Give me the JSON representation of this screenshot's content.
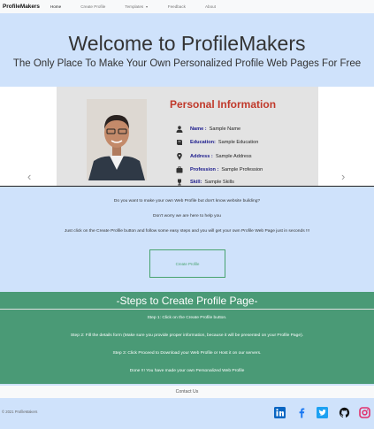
{
  "nav": {
    "brand": "ProfileMakers",
    "home": "Home",
    "create_profile": "Create Profile",
    "templates": "Templates",
    "feedback": "Feedback",
    "about": "About"
  },
  "hero": {
    "title": "Welcome to ProfileMakers",
    "subtitle": "The Only Place To Make Your Own Personalized Profile Web Pages For Free"
  },
  "carousel": {
    "heading": "Personal Information",
    "rows": [
      {
        "icon": "user-icon",
        "label": "Name :",
        "value": "Sample Name"
      },
      {
        "icon": "book-icon",
        "label": "Education:",
        "value": "Sample Education"
      },
      {
        "icon": "location-pin-icon",
        "label": "Address :",
        "value": "Sample Address"
      },
      {
        "icon": "briefcase-icon",
        "label": "Profession :",
        "value": "Sample Profession"
      },
      {
        "icon": "trophy-icon",
        "label": "Skill:",
        "value": "Sample Skills"
      }
    ],
    "prev": "‹",
    "next": "›"
  },
  "intro": {
    "line1": "Do you want to make your own Web Profile but don't know website building?",
    "line2": "Don't worry we are here to help you",
    "line3": "Just click on the Create Profile button and follow some easy steps and you will get your own Profile Web Page just in seconds !!!",
    "cta": "Create Profile"
  },
  "steps": {
    "heading": "-Steps to Create Profile Page-",
    "items": [
      "Step 1: Click on the Create Profile button.",
      "Step 2: Fill the details form (Make sure you provide proper information, because it will be presented on your Profile Page).",
      "Step 3: Click Proceed to Download your Web Profile or Host it on our servers.",
      "Done !!! You have made your own Personalized Web Profile"
    ]
  },
  "contact": {
    "label": "Contact Us"
  },
  "footer": {
    "copyright": "© 2021 ProfileMakers",
    "social": [
      "linkedin-icon",
      "facebook-icon",
      "twitter-icon",
      "github-icon",
      "instagram-icon"
    ]
  },
  "colors": {
    "accent_green": "#4a9a76",
    "heading_red": "#c0392b",
    "page_bg": "#cfe2fb"
  }
}
